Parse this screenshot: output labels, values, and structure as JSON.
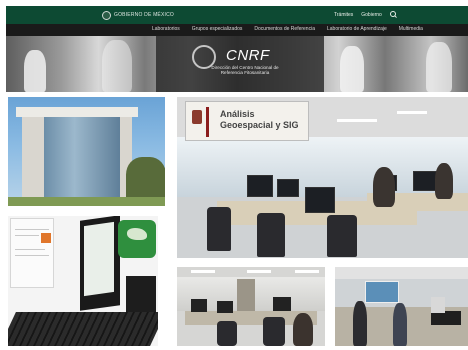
{
  "header": {
    "gov_logo_text": "GOBIERNO DE MÉXICO",
    "links": [
      "Trámites",
      "Gobierno"
    ],
    "search_icon": "search-icon",
    "bar_color": "#0d4a33"
  },
  "nav": {
    "items": [
      "Laboratorios",
      "Grupos especializados",
      "Documentos de Referencia",
      "Laboratorio de Aprendizaje",
      "Multimedia"
    ]
  },
  "hero": {
    "acronym": "CNRF",
    "subtitle": "Dirección del Centro Nacional de Referencia Fitosanitaria"
  },
  "gallery": {
    "lab_banner_title": "Análisis Geoespacial y SIG"
  },
  "colors": {
    "accent_green": "#0d4a33",
    "logo_green": "#2f8f3e",
    "banner_red": "#8b1d1d"
  }
}
